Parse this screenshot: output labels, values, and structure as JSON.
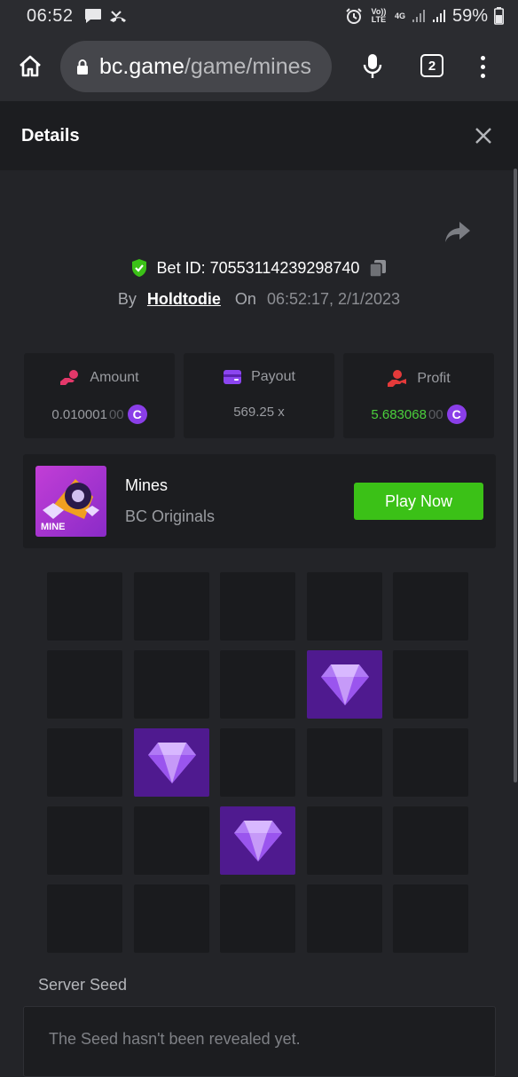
{
  "status_bar": {
    "time": "06:52",
    "volte": "Vo)) LTE",
    "network": "4G",
    "battery": "59%"
  },
  "browser": {
    "url_host": "bc.game",
    "url_path": "/game/mines",
    "tab_count": "2"
  },
  "details": {
    "title": "Details",
    "bet_id_label": "Bet ID:",
    "bet_id": "70553114239298740",
    "by_label": "By",
    "username": "Holdtodie",
    "on_label": "On",
    "timestamp": "06:52:17, 2/1/2023"
  },
  "stats": [
    {
      "label": "Amount",
      "value_main": "0.010001",
      "value_dim": "00",
      "icon": "hand-coins-icon",
      "color": "#e4386a"
    },
    {
      "label": "Payout",
      "value_main": "569.25 x",
      "value_dim": "",
      "icon": "wallet-icon",
      "color": "#8b45f0"
    },
    {
      "label": "Profit",
      "value_main": "5.683068",
      "value_dim": "00",
      "icon": "hand-profit-icon",
      "color": "#e43a3a"
    }
  ],
  "currency_symbol": "C",
  "game": {
    "thumb_label": "MINE",
    "title": "Mines",
    "subtitle": "BC Originals",
    "play_label": "Play Now"
  },
  "mines_grid": {
    "rows": 5,
    "cols": 5,
    "gems": [
      [
        1,
        3
      ],
      [
        2,
        1
      ],
      [
        3,
        2
      ]
    ]
  },
  "server_seed": {
    "label": "Server Seed",
    "value": "The Seed hasn't been revealed yet."
  },
  "colors": {
    "accent_green": "#3bc117",
    "gem_tile": "#4f1a8f",
    "profit_green": "#4bd03c"
  }
}
